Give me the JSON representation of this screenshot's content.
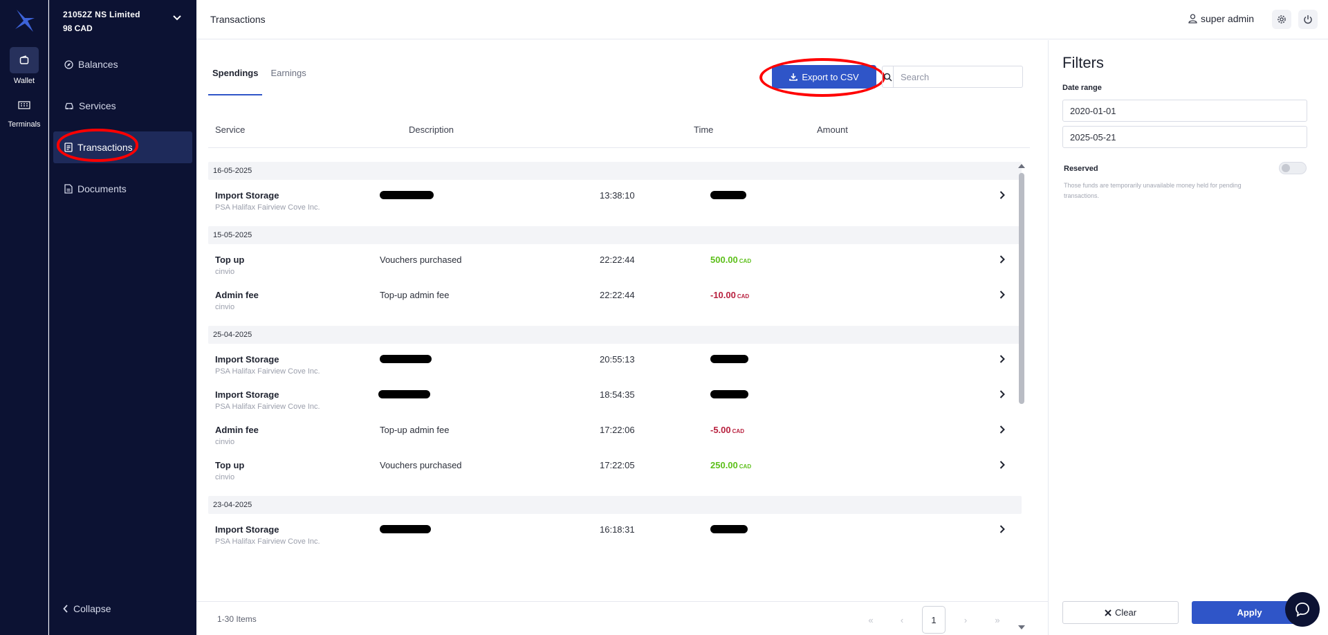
{
  "rail": {
    "items": [
      {
        "label": "Wallet",
        "icon": "wallet-icon"
      },
      {
        "label": "Terminals",
        "icon": "terminal-icon"
      }
    ]
  },
  "account": {
    "name": "21052Z NS Limited",
    "balance": "98 CAD"
  },
  "sidebar": {
    "items": [
      {
        "label": "Balances",
        "icon": "compass-icon"
      },
      {
        "label": "Services",
        "icon": "car-icon"
      },
      {
        "label": "Transactions",
        "icon": "document-icon"
      },
      {
        "label": "Documents",
        "icon": "file-icon"
      }
    ],
    "collapse_label": "Collapse"
  },
  "topbar": {
    "title": "Transactions",
    "user": "super admin"
  },
  "tabs": [
    {
      "label": "Spendings",
      "active": true
    },
    {
      "label": "Earnings",
      "active": false
    }
  ],
  "export_label": "Export to CSV",
  "search": {
    "placeholder": "Search",
    "value": ""
  },
  "table": {
    "columns": [
      "Service",
      "Description",
      "Time",
      "Amount"
    ],
    "groups": [
      {
        "date": "16-05-2025",
        "rows": [
          {
            "service": "Import Storage",
            "sub": "PSA Halifax Fairview Cove Inc.",
            "desc": "",
            "time": "13:38:10",
            "amount": "",
            "currency": "CAD",
            "redact_desc": true,
            "redact_amount": true
          }
        ]
      },
      {
        "date": "15-05-2025",
        "rows": [
          {
            "service": "Top up",
            "sub": "cinvio",
            "desc": "Vouchers purchased",
            "time": "22:22:44",
            "amount": "500.00",
            "currency": "CAD",
            "sign": "pos"
          },
          {
            "service": "Admin fee",
            "sub": "cinvio",
            "desc": "Top-up admin fee",
            "time": "22:22:44",
            "amount": "-10.00",
            "currency": "CAD",
            "sign": "neg"
          }
        ]
      },
      {
        "date": "25-04-2025",
        "rows": [
          {
            "service": "Import Storage",
            "sub": "PSA Halifax Fairview Cove Inc.",
            "desc": "",
            "time": "20:55:13",
            "amount": "",
            "currency": "CAD",
            "redact_desc": true,
            "redact_amount": true
          },
          {
            "service": "Import Storage",
            "sub": "PSA Halifax Fairview Cove Inc.",
            "desc": "",
            "time": "18:54:35",
            "amount": "",
            "currency": "CAD",
            "redact_desc": true,
            "redact_amount": true
          },
          {
            "service": "Admin fee",
            "sub": "cinvio",
            "desc": "Top-up admin fee",
            "time": "17:22:06",
            "amount": "-5.00",
            "currency": "CAD",
            "sign": "neg"
          },
          {
            "service": "Top up",
            "sub": "cinvio",
            "desc": "Vouchers purchased",
            "time": "17:22:05",
            "amount": "250.00",
            "currency": "CAD",
            "sign": "pos"
          }
        ]
      },
      {
        "date": "23-04-2025",
        "rows": [
          {
            "service": "Import Storage",
            "sub": "PSA Halifax Fairview Cove Inc.",
            "desc": "",
            "time": "16:18:31",
            "amount": "",
            "currency": "CAD",
            "redact_desc": true,
            "redact_amount": true
          }
        ]
      }
    ]
  },
  "pagination": {
    "items_label": "1-30 Items",
    "current_page": "1"
  },
  "filters": {
    "title": "Filters",
    "date_range_label": "Date range",
    "date_from": "2020-01-01",
    "date_to": "2025-05-21",
    "reserved_label": "Reserved",
    "reserved_on": false,
    "reserved_note": "Those funds are temporarily unavailable money held for pending transactions.",
    "clear_label": "Clear",
    "apply_label": "Apply"
  },
  "colors": {
    "nav_bg": "#0c1233",
    "accent": "#2f55c8",
    "positive": "#5cbf19",
    "negative": "#b8203e",
    "annotation": "#ff0000"
  }
}
